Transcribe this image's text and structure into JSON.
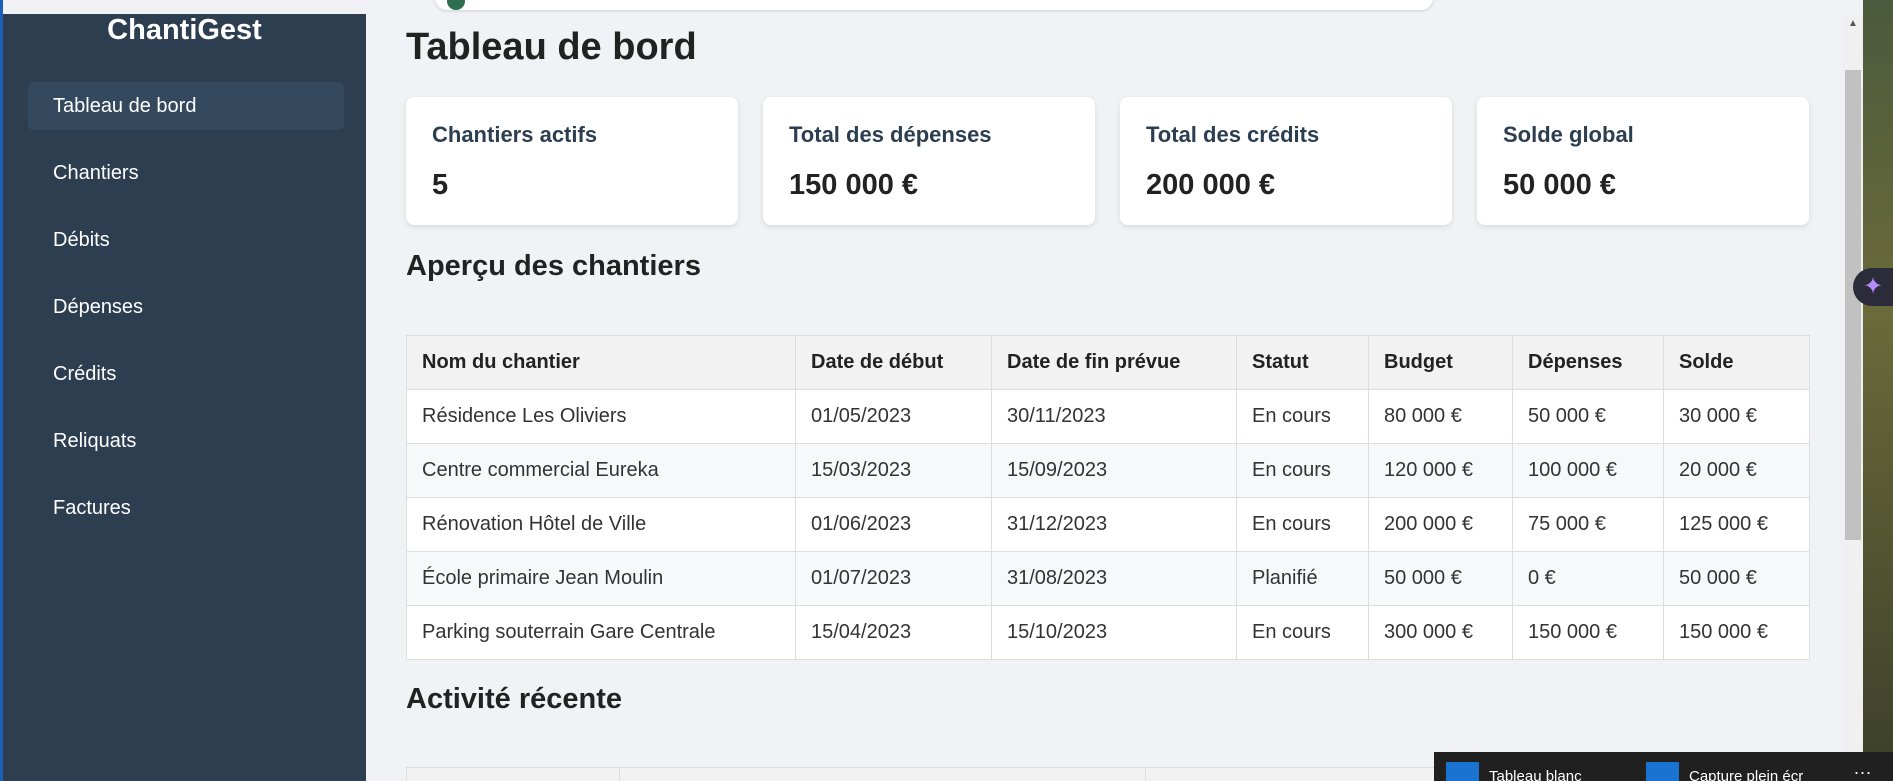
{
  "sidebar": {
    "brand": "ChantiGest",
    "items": [
      {
        "label": "Tableau de bord",
        "active": true
      },
      {
        "label": "Chantiers"
      },
      {
        "label": "Débits"
      },
      {
        "label": "Dépenses"
      },
      {
        "label": "Crédits"
      },
      {
        "label": "Reliquats"
      },
      {
        "label": "Factures"
      }
    ]
  },
  "main": {
    "title": "Tableau de bord",
    "cards": [
      {
        "label": "Chantiers actifs",
        "value": "5"
      },
      {
        "label": "Total des dépenses",
        "value": "150 000 €"
      },
      {
        "label": "Total des crédits",
        "value": "200 000 €"
      },
      {
        "label": "Solde global",
        "value": "50 000 €"
      }
    ],
    "overview_title": "Aperçu des chantiers",
    "table": {
      "headers": [
        "Nom du chantier",
        "Date de début",
        "Date de fin prévue",
        "Statut",
        "Budget",
        "Dépenses",
        "Solde"
      ],
      "rows": [
        [
          "Résidence Les Oliviers",
          "01/05/2023",
          "30/11/2023",
          "En cours",
          "80 000 €",
          "50 000 €",
          "30 000 €"
        ],
        [
          "Centre commercial Eureka",
          "15/03/2023",
          "15/09/2023",
          "En cours",
          "120 000 €",
          "100 000 €",
          "20 000 €"
        ],
        [
          "Rénovation Hôtel de Ville",
          "01/06/2023",
          "31/12/2023",
          "En cours",
          "200 000 €",
          "75 000 €",
          "125 000 €"
        ],
        [
          "École primaire Jean Moulin",
          "01/07/2023",
          "31/08/2023",
          "Planifié",
          "50 000 €",
          "0 €",
          "50 000 €"
        ],
        [
          "Parking souterrain Gare Centrale",
          "15/04/2023",
          "15/10/2023",
          "En cours",
          "300 000 €",
          "150 000 €",
          "150 000 €"
        ]
      ]
    },
    "activity_title": "Activité récente"
  },
  "taskbar": {
    "items": [
      {
        "label": "Tableau blanc",
        "icon": "whiteboard-icon"
      },
      {
        "label": "Capture plein écr",
        "icon": "screenshot-icon"
      }
    ],
    "more": "..."
  },
  "icons": {
    "copilot": "sparkle-icon",
    "scroll_up": "triangle-up-icon"
  },
  "colors": {
    "sidebar_bg": "#2c3e50",
    "sidebar_active": "#34495e",
    "page_bg": "#f0f2f5",
    "accent_blue": "#1a73d1"
  }
}
